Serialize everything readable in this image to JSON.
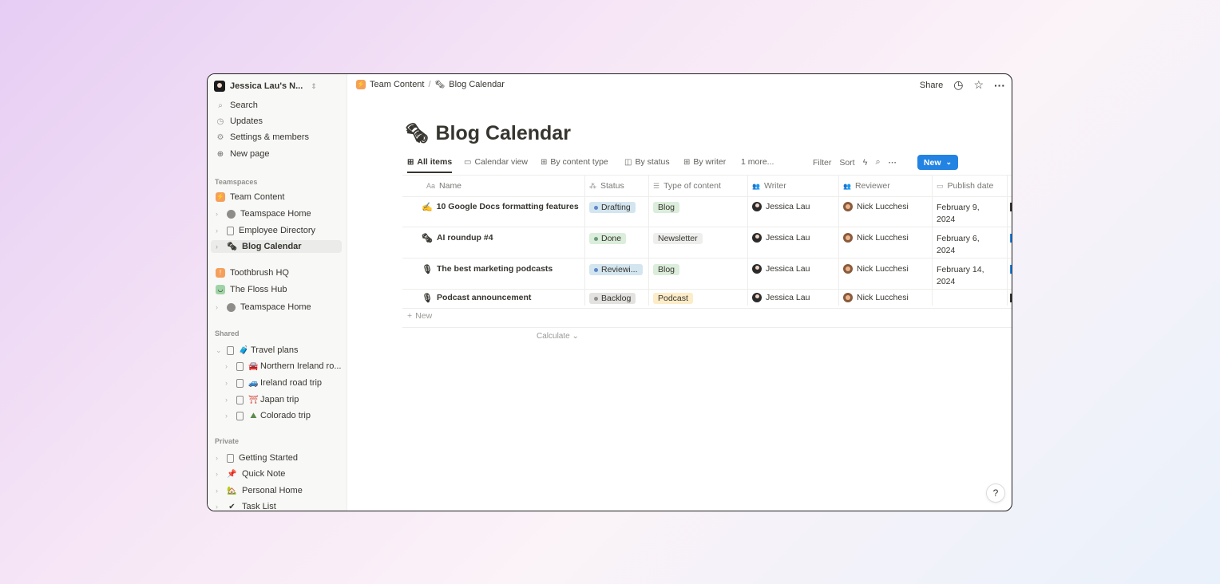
{
  "sidebar": {
    "workspace": "Jessica Lau's N...",
    "top": [
      {
        "label": "Search",
        "icon": "search-icon",
        "glyph": "⚲"
      },
      {
        "label": "Updates",
        "icon": "clock-icon",
        "glyph": "◷"
      },
      {
        "label": "Settings & members",
        "icon": "gear-icon",
        "glyph": "⚙"
      },
      {
        "label": "New page",
        "icon": "plus-circle-icon",
        "glyph": "⊕"
      }
    ],
    "teamspaces_label": "Teamspaces",
    "teamspaces": [
      {
        "label": "Team Content",
        "emoji": "⚡"
      },
      {
        "label": "Teamspace Home",
        "emoji": "◐"
      },
      {
        "label": "Employee Directory",
        "emoji": ""
      },
      {
        "label": "Blog Calendar",
        "emoji": "🗞"
      },
      {
        "label": "Toothbrush HQ",
        "emoji": "🪥"
      },
      {
        "label": "The Floss Hub",
        "emoji": "🦷"
      },
      {
        "label": "Teamspace Home",
        "emoji": "◐"
      }
    ],
    "shared_label": "Shared",
    "shared": [
      {
        "label": "Travel plans",
        "emoji": "🧳"
      },
      {
        "label": "Northern Ireland ro...",
        "emoji": "🚘"
      },
      {
        "label": "Ireland road trip",
        "emoji": "🚙"
      },
      {
        "label": "Japan trip",
        "emoji": "⛩"
      },
      {
        "label": "Colorado trip",
        "emoji": "⛰"
      }
    ],
    "private_label": "Private",
    "private": [
      {
        "label": "Getting Started",
        "emoji": ""
      },
      {
        "label": "Quick Note",
        "emoji": "📌"
      },
      {
        "label": "Personal Home",
        "emoji": "🏡"
      },
      {
        "label": "Task List",
        "emoji": "✔"
      }
    ]
  },
  "topbar": {
    "crumb1": "Team Content",
    "sep": "/",
    "crumb2": "Blog Calendar",
    "share": "Share"
  },
  "page": {
    "title": "Blog Calendar",
    "title_emoji": "🗞",
    "tabs": [
      "All items",
      "Calendar view",
      "By content type",
      "By status",
      "By writer",
      "1 more..."
    ],
    "tools": {
      "filter": "Filter",
      "sort": "Sort",
      "new": "New"
    }
  },
  "table": {
    "columns": [
      {
        "label": "Name",
        "icon": "Aa"
      },
      {
        "label": "Status",
        "icon": "⁂"
      },
      {
        "label": "Type of content",
        "icon": "☰"
      },
      {
        "label": "Writer",
        "icon": "👥"
      },
      {
        "label": "Reviewer",
        "icon": "👥"
      },
      {
        "label": "Publish date",
        "icon": "▭"
      }
    ],
    "rows": [
      {
        "emoji": "✍",
        "name": "10 Google Docs formatting features",
        "status": "Drafting",
        "type": "Blog",
        "writer": "Jessica Lau",
        "reviewer": "Nick Lucchesi",
        "date1": "February 9,",
        "date2": "2024"
      },
      {
        "emoji": "🗞",
        "name": "AI roundup #4",
        "status": "Done",
        "type": "Newsletter",
        "writer": "Jessica Lau",
        "reviewer": "Nick Lucchesi",
        "date1": "February 6,",
        "date2": "2024"
      },
      {
        "emoji": "🎙",
        "name": "The best marketing podcasts",
        "status": "Reviewi...",
        "type": "Blog",
        "writer": "Jessica Lau",
        "reviewer": "Nick Lucchesi",
        "date1": "February 14,",
        "date2": "2024"
      },
      {
        "emoji": "🎙",
        "name": "Podcast announcement",
        "status": "Backlog",
        "type": "Podcast",
        "writer": "Jessica Lau",
        "reviewer": "Nick Lucchesi",
        "date1": "",
        "date2": ""
      }
    ],
    "new_row": "New",
    "calculate": "Calculate"
  },
  "colors": {
    "accent": "#2383e2",
    "drafting_bg": "#d3e5ef",
    "drafting_dot": "#5e87c9",
    "done_bg": "#dbeddb",
    "done_dot": "#6c9b7d",
    "reviewing_bg": "#d3e5ef",
    "reviewing_dot": "#5e87c9",
    "backlog_bg": "#e3e2e0",
    "backlog_dot": "#91918e",
    "blog_bg": "#dbeddb",
    "newsletter_bg": "#eeeeed",
    "podcast_bg": "#fdecc8"
  },
  "help": "?"
}
